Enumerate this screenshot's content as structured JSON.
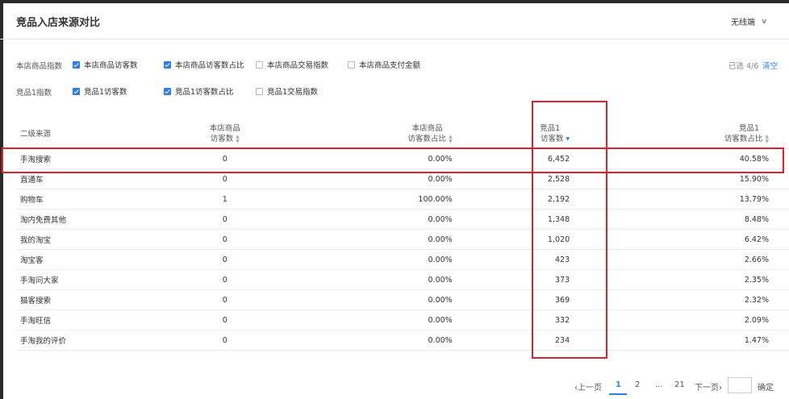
{
  "panel": {
    "title": "竞品入店来源对比",
    "mode": "无线端"
  },
  "filters": [
    {
      "label": "本店商品指数",
      "options": [
        {
          "label": "本店商品访客数",
          "checked": true
        },
        {
          "label": "本店商品访客数占比",
          "checked": true
        },
        {
          "label": "本店商品交易指数",
          "checked": false
        },
        {
          "label": "本店商品支付金额",
          "checked": false
        }
      ]
    },
    {
      "label": "竞品1指数",
      "options": [
        {
          "label": "竞品1访客数",
          "checked": true
        },
        {
          "label": "竞品1访客数占比",
          "checked": true
        },
        {
          "label": "竞品1交易指数",
          "checked": false
        }
      ]
    }
  ],
  "selection": {
    "count": "已选 4/6",
    "clear": "清空"
  },
  "table": {
    "columns": [
      {
        "line1": "二级来源",
        "line2": ""
      },
      {
        "line1": "本店商品",
        "line2": "访客数"
      },
      {
        "line1": "本店商品",
        "line2": "访客数占比"
      },
      {
        "line1": "竞品1",
        "line2": "访客数"
      },
      {
        "line1": "竞品1",
        "line2": "访客数占比"
      }
    ],
    "sorted_column": 3,
    "rows": [
      [
        "手淘搜索",
        "0",
        "0.00%",
        "6,452",
        "40.58%"
      ],
      [
        "直通车",
        "0",
        "0.00%",
        "2,528",
        "15.90%"
      ],
      [
        "购物车",
        "1",
        "100.00%",
        "2,192",
        "13.79%"
      ],
      [
        "淘内免费其他",
        "0",
        "0.00%",
        "1,348",
        "8.48%"
      ],
      [
        "我的淘宝",
        "0",
        "0.00%",
        "1,020",
        "6.42%"
      ],
      [
        "淘宝客",
        "0",
        "0.00%",
        "423",
        "2.66%"
      ],
      [
        "手淘问大家",
        "0",
        "0.00%",
        "373",
        "2.35%"
      ],
      [
        "猫客搜索",
        "0",
        "0.00%",
        "369",
        "2.32%"
      ],
      [
        "手淘旺信",
        "0",
        "0.00%",
        "332",
        "2.09%"
      ],
      [
        "手淘我的评价",
        "0",
        "0.00%",
        "234",
        "1.47%"
      ]
    ]
  },
  "pagination": {
    "prev": "上一页",
    "pages": [
      "1",
      "2",
      "...",
      "21"
    ],
    "current": "1",
    "next": "下一页",
    "confirm": "确定"
  },
  "colors": {
    "accent": "#2d7ee6",
    "highlight": "#d9232e"
  }
}
